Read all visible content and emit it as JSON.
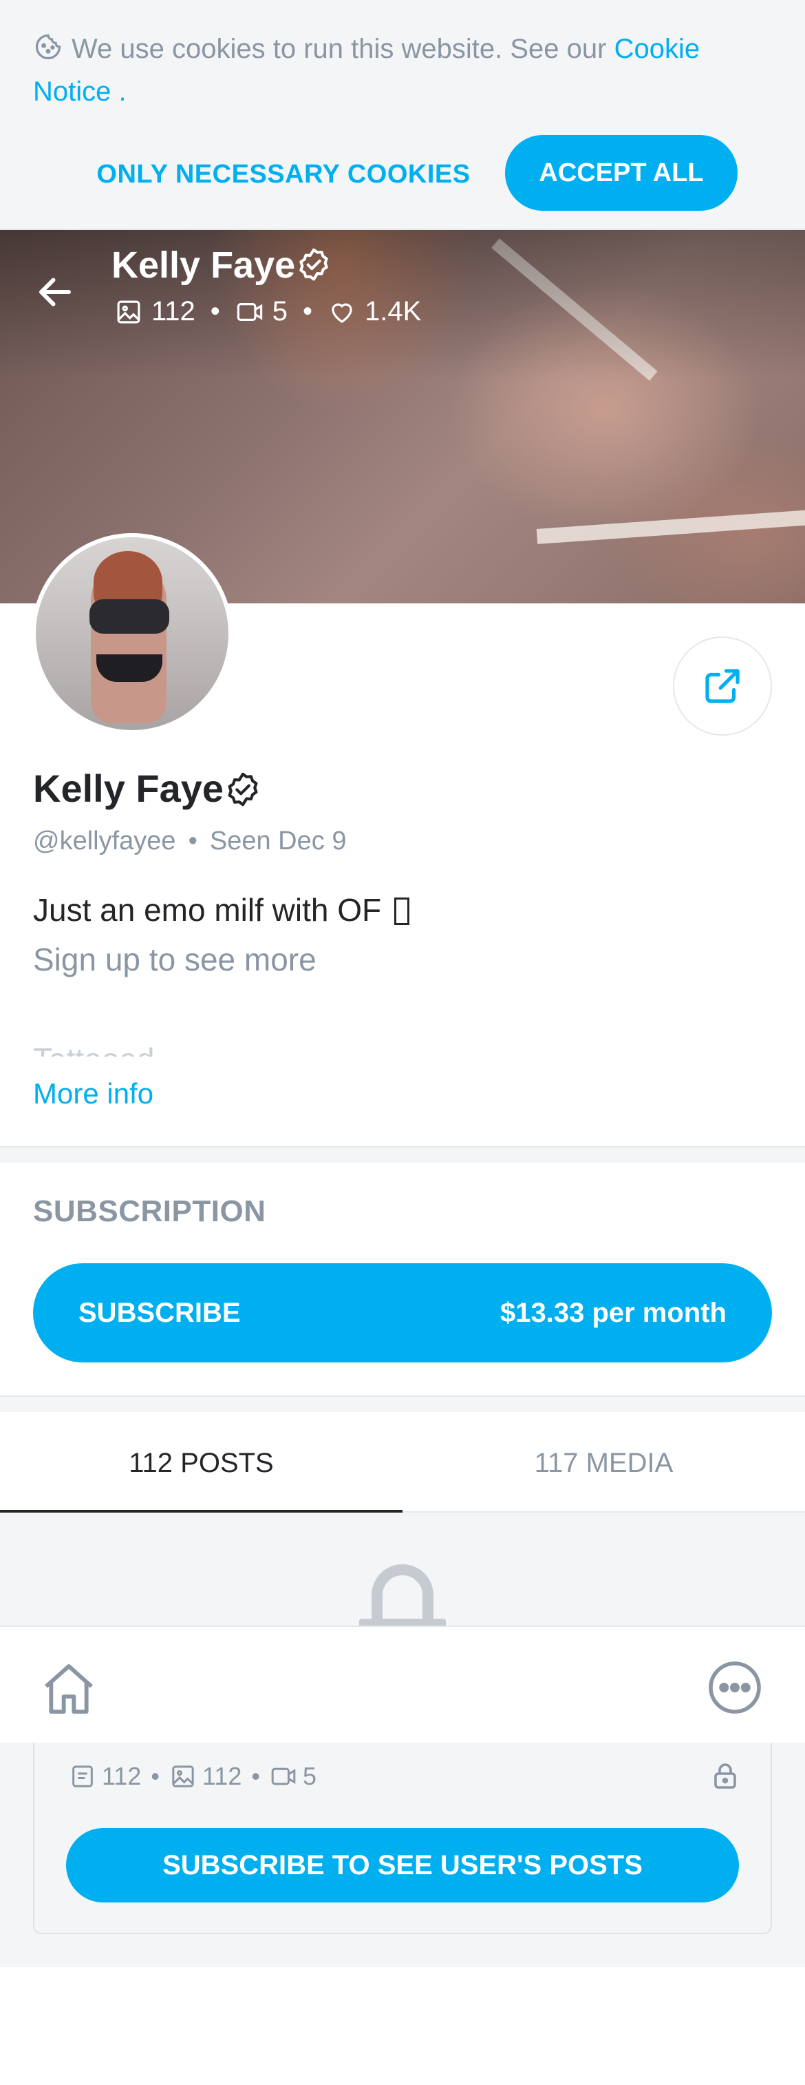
{
  "cookie_banner": {
    "text": "We use cookies to run this website. See our",
    "link": "Cookie Notice",
    "suffix": " .",
    "only_necessary_label": "ONLY NECESSARY COOKIES",
    "accept_all_label": "ACCEPT ALL"
  },
  "cover": {
    "name": "Kelly Faye",
    "photos": "112",
    "videos": "5",
    "likes": "1.4K"
  },
  "profile": {
    "name": "Kelly Faye",
    "handle": "@kellyfayee",
    "separator": "•",
    "seen": "Seen  Dec 9",
    "bio": "Just an emo milf with OF",
    "signup": "Sign up to see more",
    "faded_line": "Tattooed",
    "more_info": "More info"
  },
  "subscription": {
    "title": "SUBSCRIPTION",
    "button_label": "SUBSCRIBE",
    "price": "$13.33 per month"
  },
  "tabs": [
    {
      "label": "112 POSTS",
      "active": true
    },
    {
      "label": "117 MEDIA",
      "active": false
    }
  ],
  "locked_card": {
    "posts": "112",
    "photos": "112",
    "videos": "5",
    "button_label": "SUBSCRIBE TO SEE USER'S POSTS"
  },
  "colors": {
    "accent": "#00aff0",
    "muted": "#8a96a3",
    "text": "#242529",
    "background_alt": "#f4f5f7"
  },
  "icons": [
    "cookie-icon",
    "back-arrow-icon",
    "verified-icon",
    "image-icon",
    "video-icon",
    "heart-icon",
    "share-icon",
    "lock-icon",
    "home-icon",
    "more-icon",
    "post-icon"
  ]
}
